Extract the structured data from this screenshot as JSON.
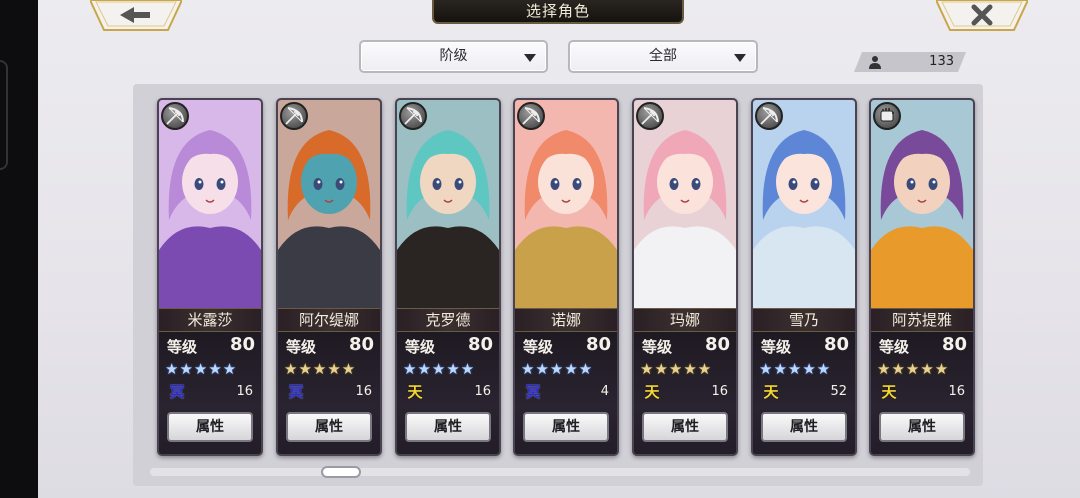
{
  "header": {
    "title": "选择角色"
  },
  "filters": {
    "rank_label": "阶级",
    "all_label": "全部"
  },
  "roster_count": "133",
  "level_label": "等级",
  "attr_label": "属性",
  "colors": {
    "star_blue": "#bcd8ff",
    "star_gold": "#e8d291",
    "element_ming": "#2a2cc7",
    "element_tian": "#f6d830"
  },
  "cards": [
    {
      "name": "米露莎",
      "level": "80",
      "stars": "★★★★★",
      "star_color": "blue",
      "element": "冥",
      "element_type": "ming",
      "value": "16",
      "class_icon": "bow-icon",
      "hair": "#b88ad8",
      "skin": "#f6dfe8",
      "bg": "#d8b8e8",
      "outfit": "#7b4bb1"
    },
    {
      "name": "阿尔缇娜",
      "level": "80",
      "stars": "★★★★★",
      "star_color": "gold",
      "element": "冥",
      "element_type": "ming",
      "value": "16",
      "class_icon": "bow-icon",
      "hair": "#d86a2a",
      "skin": "#4fa3b0",
      "bg": "#c9a79a",
      "outfit": "#3a3b45"
    },
    {
      "name": "克罗德",
      "level": "80",
      "stars": "★★★★★",
      "star_color": "blue",
      "element": "天",
      "element_type": "tian",
      "value": "16",
      "class_icon": "bow-icon",
      "hair": "#5ec7c2",
      "skin": "#efd7c2",
      "bg": "#9bbfc2",
      "outfit": "#2a2423"
    },
    {
      "name": "诺娜",
      "level": "80",
      "stars": "★★★★★",
      "star_color": "blue",
      "element": "冥",
      "element_type": "ming",
      "value": "4",
      "class_icon": "bow-icon",
      "hair": "#f08a6a",
      "skin": "#fbe2d8",
      "bg": "#f4b7b0",
      "outfit": "#c8a14a"
    },
    {
      "name": "玛娜",
      "level": "80",
      "stars": "★★★★★",
      "star_color": "gold",
      "element": "天",
      "element_type": "tian",
      "value": "16",
      "class_icon": "bow-icon",
      "hair": "#f0a8b8",
      "skin": "#fbe3dc",
      "bg": "#e8d2d6",
      "outfit": "#f2f2f4"
    },
    {
      "name": "雪乃",
      "level": "80",
      "stars": "★★★★★",
      "star_color": "blue",
      "element": "天",
      "element_type": "tian",
      "value": "52",
      "class_icon": "bow-icon",
      "hair": "#5d87d6",
      "skin": "#fae4dc",
      "bg": "#b9d2ee",
      "outfit": "#d8e6f2"
    },
    {
      "name": "阿苏提雅",
      "level": "80",
      "stars": "★★★★★",
      "star_color": "gold",
      "element": "天",
      "element_type": "tian",
      "value": "16",
      "class_icon": "fist-icon",
      "hair": "#7a4a9a",
      "skin": "#f2d2bf",
      "bg": "#a8c8d6",
      "outfit": "#e89a2a"
    }
  ]
}
